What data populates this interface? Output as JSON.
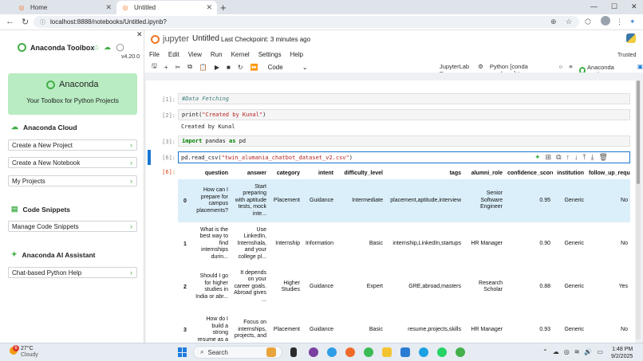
{
  "browser": {
    "tabs": [
      {
        "label": "Home"
      },
      {
        "label": "Untitled"
      }
    ],
    "url": "localhost:8888/notebooks/Untitled.ipynb?"
  },
  "sidebar": {
    "brand": "Anaconda Toolbox",
    "version": "v4.20.0",
    "hero_title": "Anaconda",
    "hero_subtitle": "Your Toolbox for Python Projects",
    "cloud_heading": "Anaconda Cloud",
    "cloud_items": [
      "Create a New Project",
      "Create a New Notebook",
      "My Projects"
    ],
    "snippets_heading": "Code Snippets",
    "snippets_items": [
      "Manage Code Snippets"
    ],
    "ai_heading": "Anaconda AI Assistant",
    "ai_items": [
      "Chat-based Python Help"
    ]
  },
  "jupyter": {
    "logo_text": "jupyter",
    "notebook_title": "Untitled",
    "checkpoint": "Last Checkpoint: 3 minutes ago",
    "menu": [
      "File",
      "Edit",
      "View",
      "Run",
      "Kernel",
      "Settings",
      "Help"
    ],
    "trusted": "Trusted",
    "cell_type": "Code",
    "jupyterlab_link": "JupyterLab",
    "kernel": "Python [conda env:base] *",
    "toolbox_label": "Anaconda Toolbox"
  },
  "cells": {
    "c1": {
      "prompt": "[1]:",
      "code": "#Data Fetching"
    },
    "c2": {
      "prompt": "[2]:",
      "code_fn": "print",
      "code_str": "\"Created by Kunal\"",
      "output": "Created by Kunal"
    },
    "c3": {
      "prompt": "[3]:",
      "kw1": "import",
      "mod": " pandas ",
      "kw2": "as",
      "alias": " pd"
    },
    "c4": {
      "prompt": "[6]:",
      "code_pre": "pd.read_csv(",
      "code_str": "\"twin_alumania_chatbot_dataset_v2.csv\"",
      "code_post": ")",
      "out_prompt": "[6]:"
    }
  },
  "dataframe": {
    "columns": [
      "",
      "question",
      "answer",
      "category",
      "intent",
      "difficulty_level",
      "tags",
      "alumni_role",
      "confidence_score",
      "institution",
      "follow_up_required"
    ],
    "rows": [
      {
        "index": "0",
        "question": "How can I prepare for campus placements?",
        "answer": "Start preparing with aptitude tests, mock inte...",
        "category": "Placement",
        "intent": "Guidance",
        "difficulty_level": "Intermediate",
        "tags": "placement,aptitude,interview",
        "alumni_role": "Senior Software Engineer",
        "confidence_score": "0.95",
        "institution": "Generic",
        "follow_up_required": "No"
      },
      {
        "index": "1",
        "question": "What is the best way to find internships durin...",
        "answer": "Use LinkedIn, Internshala, and your college pl...",
        "category": "Internship",
        "intent": "Information",
        "difficulty_level": "Basic",
        "tags": "internship,LinkedIn,startups",
        "alumni_role": "HR Manager",
        "confidence_score": "0.90",
        "institution": "Generic",
        "follow_up_required": "No"
      },
      {
        "index": "2",
        "question": "Should I go for higher studies in India or abr...",
        "answer": "It depends on your career goals. Abroad gives ...",
        "category": "Higher Studies",
        "intent": "Guidance",
        "difficulty_level": "Expert",
        "tags": "GRE,abroad,masters",
        "alumni_role": "Research Scholar",
        "confidence_score": "0.88",
        "institution": "Generic",
        "follow_up_required": "Yes"
      },
      {
        "index": "3",
        "question": "How do I build a strong resume as a",
        "answer": "Focus on internships, projects, and",
        "category": "Placement",
        "intent": "Guidance",
        "difficulty_level": "Basic",
        "tags": "resume,projects,skills",
        "alumni_role": "HR Manager",
        "confidence_score": "0.93",
        "institution": "Generic",
        "follow_up_required": "No"
      }
    ]
  },
  "taskbar": {
    "temperature": "27°C",
    "weather": "Cloudy",
    "weather_badge": "6",
    "search_placeholder": "Search",
    "time": "1:48 PM",
    "date": "9/2/2025"
  },
  "colors": {
    "anaconda_green": "#43b049",
    "active_cell": "#1976d2",
    "row_highlight": "#dbeffa"
  }
}
